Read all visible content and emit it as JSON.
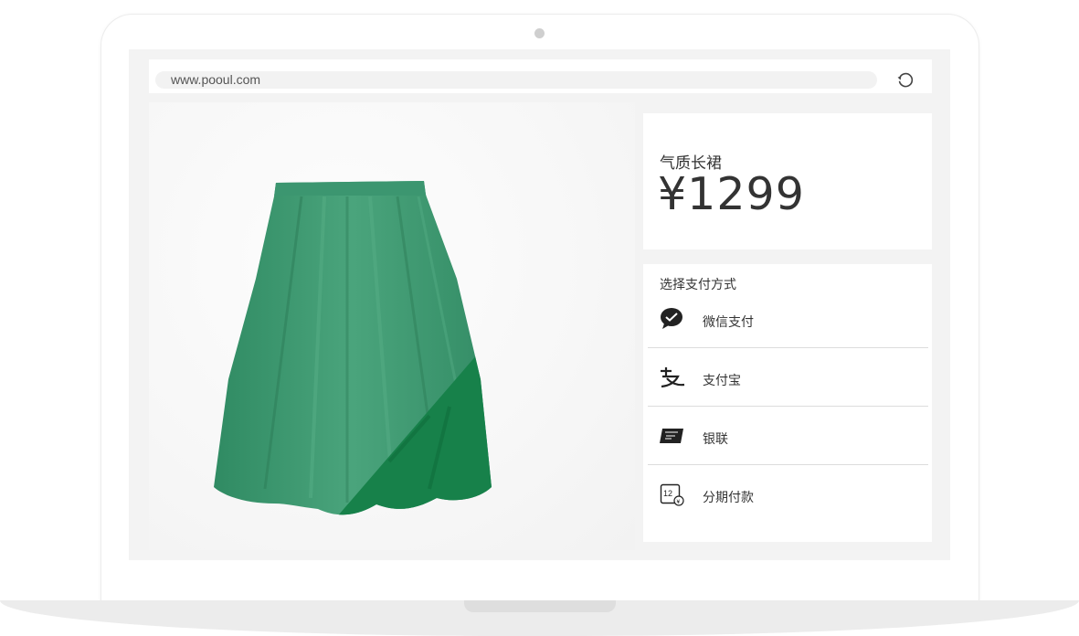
{
  "browser": {
    "url": "www.pooul.com",
    "reload_icon": "reload-icon"
  },
  "product": {
    "name": "气质长裙",
    "price": "¥1299",
    "image": "green-skirt"
  },
  "payment": {
    "title": "选择支付方式",
    "methods": [
      {
        "label": "微信支付",
        "icon": "wechat-pay-icon"
      },
      {
        "label": "支付宝",
        "icon": "alipay-icon"
      },
      {
        "label": "银联",
        "icon": "unionpay-icon"
      },
      {
        "label": "分期付款",
        "icon": "installment-icon"
      }
    ]
  },
  "colors": {
    "skirt": "#3f9b72",
    "skirt_shadow": "#17814a",
    "text": "#333333"
  }
}
